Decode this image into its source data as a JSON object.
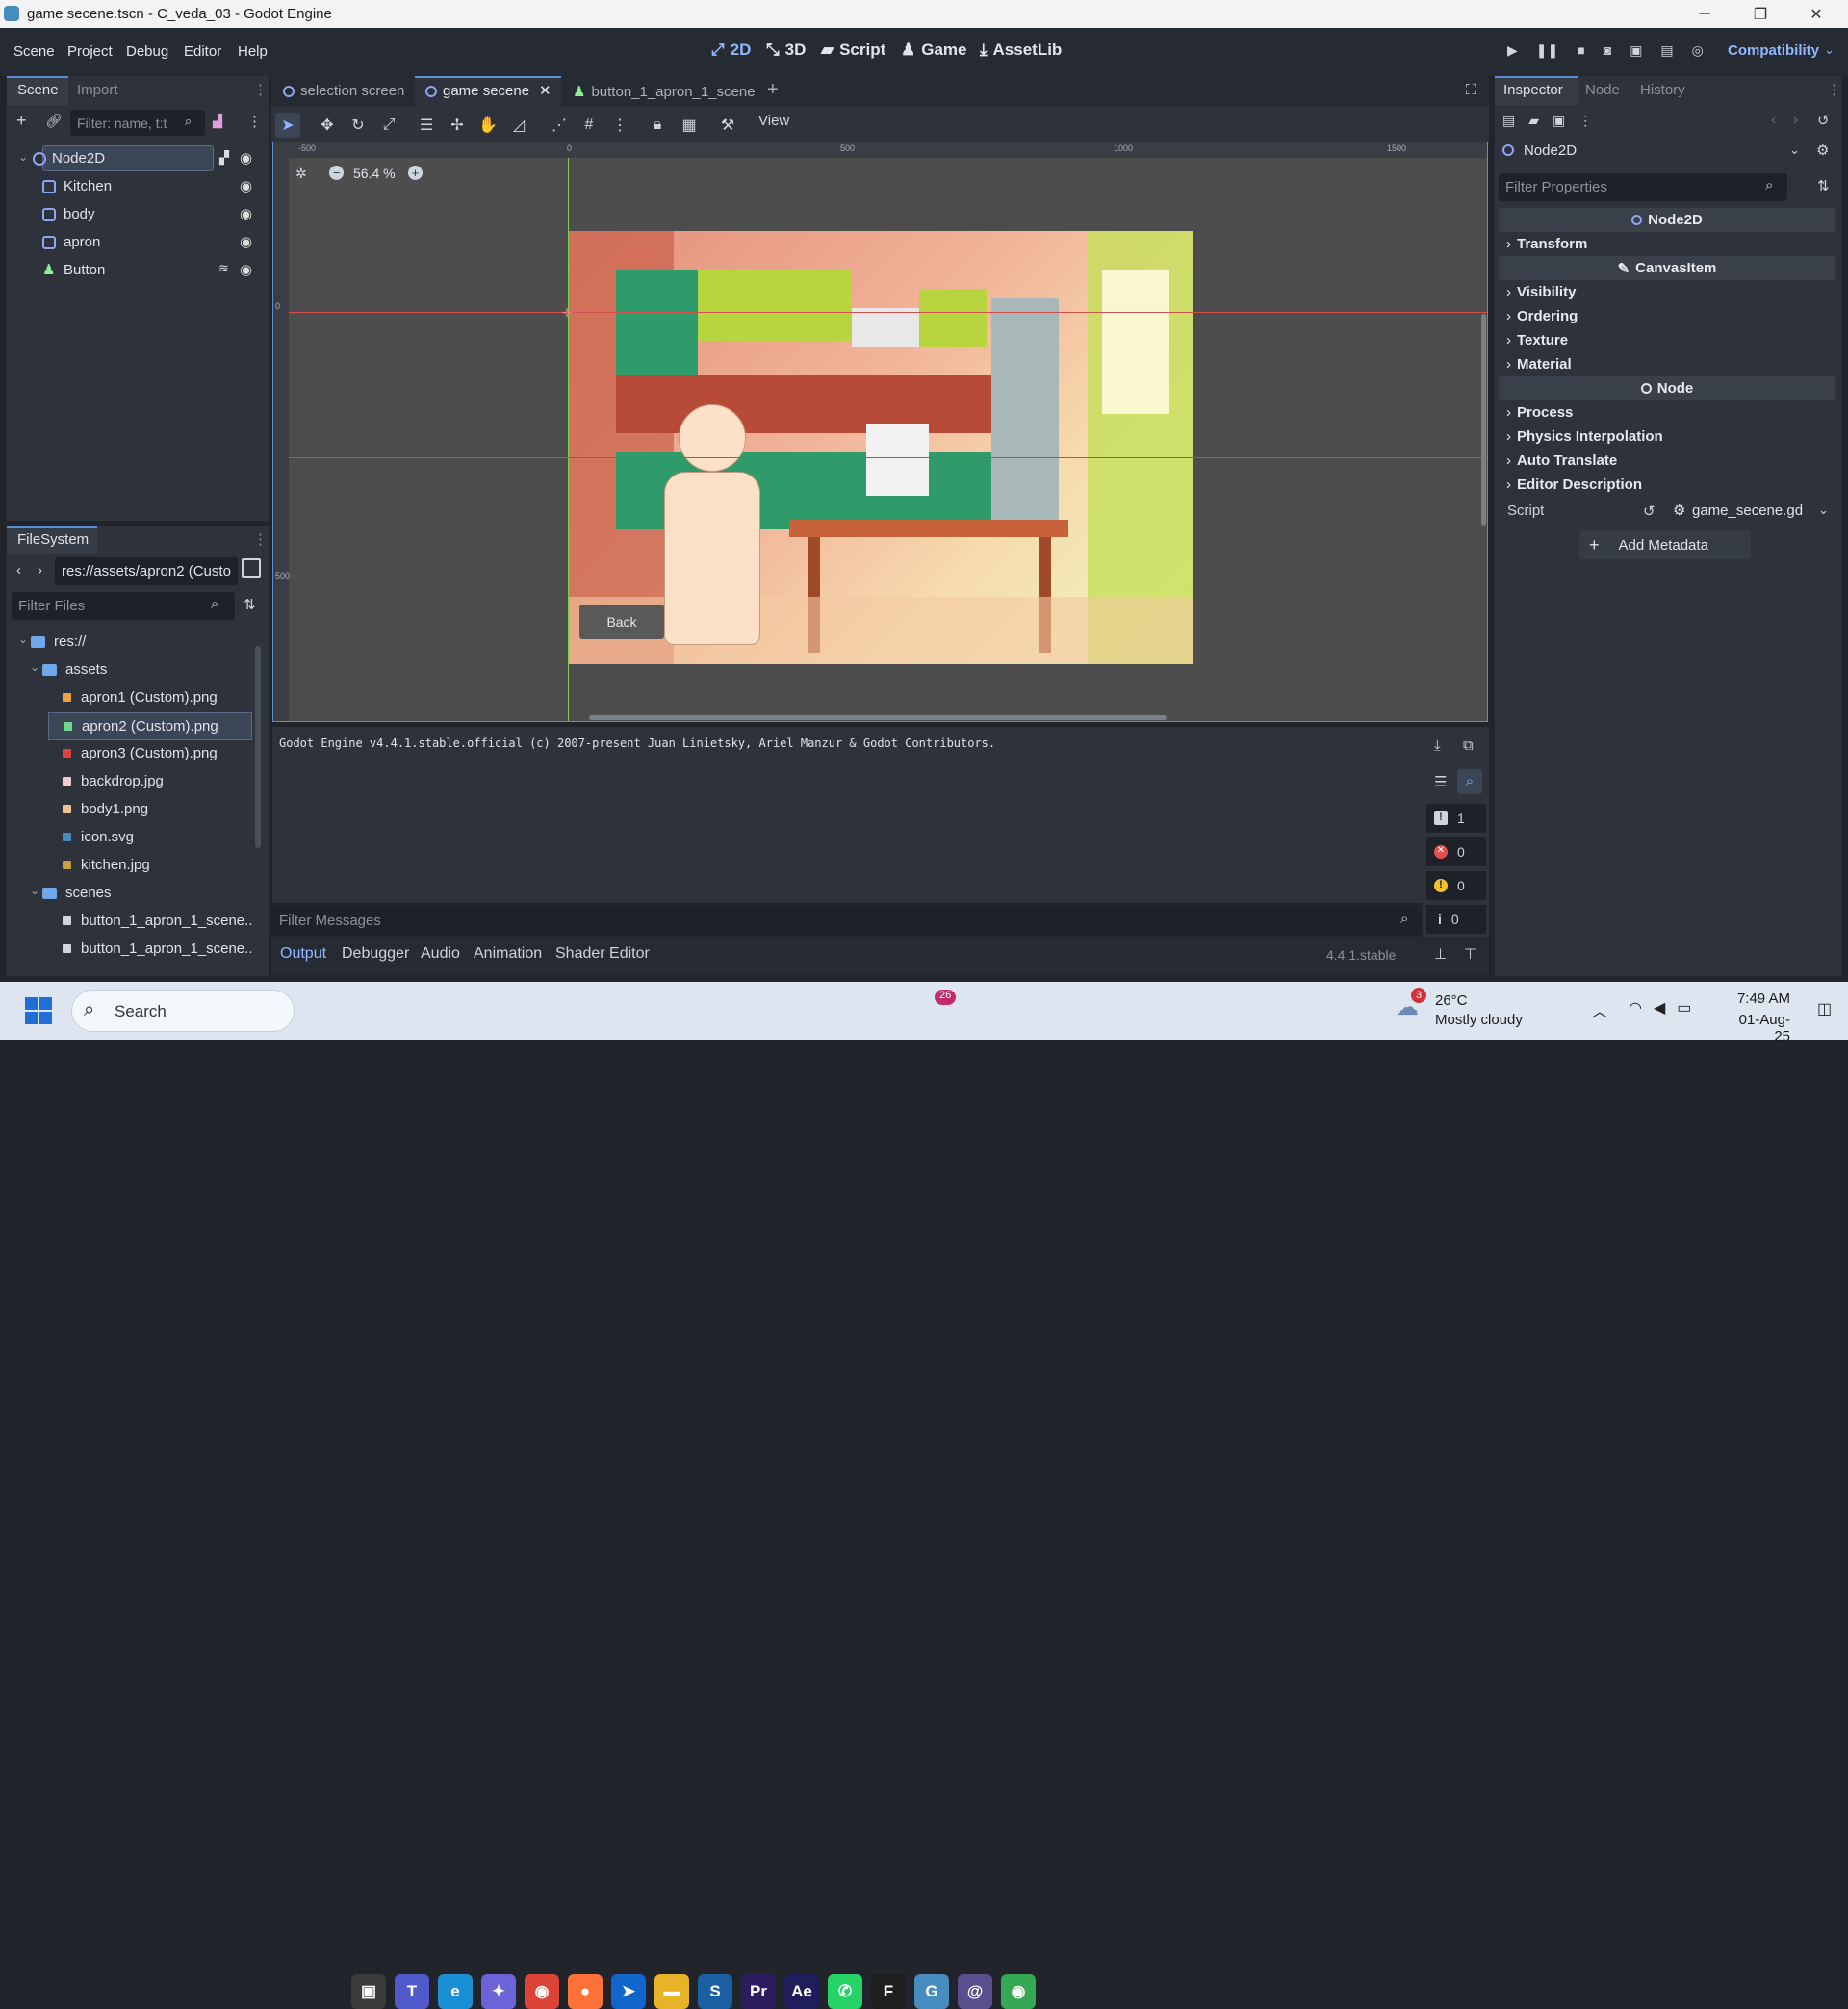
{
  "window": {
    "title": "game secene.tscn - C_veda_03 - Godot Engine",
    "min": "─",
    "max": "❐",
    "close": "✕"
  },
  "menu": [
    "Scene",
    "Project",
    "Debug",
    "Editor",
    "Help"
  ],
  "workspaces": [
    {
      "label": "2D",
      "icon": "⤢"
    },
    {
      "label": "3D",
      "icon": "⤡"
    },
    {
      "label": "Script",
      "icon": "▰"
    },
    {
      "label": "Game",
      "icon": "♟"
    },
    {
      "label": "AssetLib",
      "icon": "⤓"
    }
  ],
  "renderer": "Compatibility",
  "scene_dock": {
    "tabs": [
      "Scene",
      "Import"
    ],
    "filter_placeholder": "Filter: name, t:t",
    "nodes": [
      {
        "name": "Node2D",
        "color": "#8da5f3"
      },
      {
        "name": "Kitchen",
        "color": "#8da5f3"
      },
      {
        "name": "body",
        "color": "#8da5f3"
      },
      {
        "name": "apron",
        "color": "#8da5f3"
      },
      {
        "name": "Button",
        "color": "#8eef97"
      }
    ]
  },
  "filesystem": {
    "title": "FileSystem",
    "path": "res://assets/apron2 (Custo",
    "filter_placeholder": "Filter Files",
    "items": [
      {
        "name": "res://",
        "indent": 0,
        "kind": "folder",
        "arrow": "⌄"
      },
      {
        "name": "assets",
        "indent": 1,
        "kind": "folder",
        "arrow": "⌄"
      },
      {
        "name": "apron1 (Custom).png",
        "indent": 2,
        "kind": "file",
        "color": "#f0a040"
      },
      {
        "name": "apron2 (Custom).png",
        "indent": 2,
        "kind": "file",
        "color": "#6fd68a"
      },
      {
        "name": "apron3 (Custom).png",
        "indent": 2,
        "kind": "file",
        "color": "#e04040"
      },
      {
        "name": "backdrop.jpg",
        "indent": 2,
        "kind": "file",
        "color": "#f6c9d0"
      },
      {
        "name": "body1.png",
        "indent": 2,
        "kind": "file",
        "color": "#f0c090"
      },
      {
        "name": "icon.svg",
        "indent": 2,
        "kind": "file",
        "color": "#478cbf"
      },
      {
        "name": "kitchen.jpg",
        "indent": 2,
        "kind": "file",
        "color": "#c8a040"
      },
      {
        "name": "scenes",
        "indent": 1,
        "kind": "folder",
        "arrow": "⌄"
      },
      {
        "name": "button_1_apron_1_scene....",
        "indent": 2,
        "kind": "file",
        "color": "#cfd5de"
      },
      {
        "name": "button_1_apron_1_scene....",
        "indent": 2,
        "kind": "file",
        "color": "#cfd5de"
      }
    ]
  },
  "scene_tabs": [
    "selection screen",
    "game secene",
    "button_1_apron_1_scene"
  ],
  "toolbar": {
    "view": "View"
  },
  "viewport": {
    "zoom": "56.4 %",
    "ruler": [
      "-500",
      "0",
      "500",
      "1000",
      "1500"
    ],
    "ruler_v": [
      "0",
      "500"
    ],
    "back_button": "Back"
  },
  "output": {
    "text": "Godot Engine v4.4.1.stable.official (c) 2007-present Juan Linietsky, Ariel Manzur & Godot Contributors.",
    "filter_placeholder": "Filter Messages",
    "counts": [
      "1",
      "0",
      "0",
      "0"
    ],
    "version": "4.4.1.stable"
  },
  "bottom_tabs": [
    "Output",
    "Debugger",
    "Audio",
    "Animation",
    "Shader Editor"
  ],
  "inspector": {
    "tabs": [
      "Inspector",
      "Node",
      "History"
    ],
    "node": "Node2D",
    "filter_placeholder": "Filter Properties",
    "cat1": "Node2D",
    "transform": "Transform",
    "cat2": "CanvasItem",
    "canvas_props": [
      "Visibility",
      "Ordering",
      "Texture",
      "Material"
    ],
    "cat3": "Node",
    "node_props": [
      "Process",
      "Physics Interpolation",
      "Auto Translate",
      "Editor Description"
    ],
    "script_label": "Script",
    "script_value": "game_secene.gd",
    "add_metadata": "Add Metadata"
  },
  "taskbar": {
    "search": "Search",
    "weather_temp": "26°C",
    "weather_desc": "Mostly cloudy",
    "weather_badge": "3",
    "time": "7:49 AM",
    "date": "01-Aug-25",
    "whatsapp_badge": "26",
    "apps": [
      {
        "name": "task-view",
        "glyph": "▣",
        "bg": "#3b3b3b"
      },
      {
        "name": "teams",
        "glyph": "T",
        "bg": "#5059c9"
      },
      {
        "name": "edge",
        "glyph": "e",
        "bg": "#1b8fd6"
      },
      {
        "name": "copilot",
        "glyph": "✦",
        "bg": "#6d63d8"
      },
      {
        "name": "chrome",
        "glyph": "◉",
        "bg": "#db4437"
      },
      {
        "name": "firefox",
        "glyph": "●",
        "bg": "#ff7139"
      },
      {
        "name": "maps",
        "glyph": "➤",
        "bg": "#1166cc"
      },
      {
        "name": "files",
        "glyph": "▬",
        "bg": "#e8b427"
      },
      {
        "name": "sketchup",
        "glyph": "S",
        "bg": "#1b5fa3"
      },
      {
        "name": "premiere",
        "glyph": "Pr",
        "bg": "#2a1c5e"
      },
      {
        "name": "after-effects",
        "glyph": "Ae",
        "bg": "#1f1d5a"
      },
      {
        "name": "whatsapp",
        "glyph": "✆",
        "bg": "#25d366"
      },
      {
        "name": "figma",
        "glyph": "F",
        "bg": "#1e1e1e"
      },
      {
        "name": "godot",
        "glyph": "G",
        "bg": "#478cbf"
      },
      {
        "name": "app-swirl",
        "glyph": "@",
        "bg": "#5a4f8c"
      },
      {
        "name": "chrome-profile",
        "glyph": "◉",
        "bg": "#34a853"
      }
    ]
  }
}
